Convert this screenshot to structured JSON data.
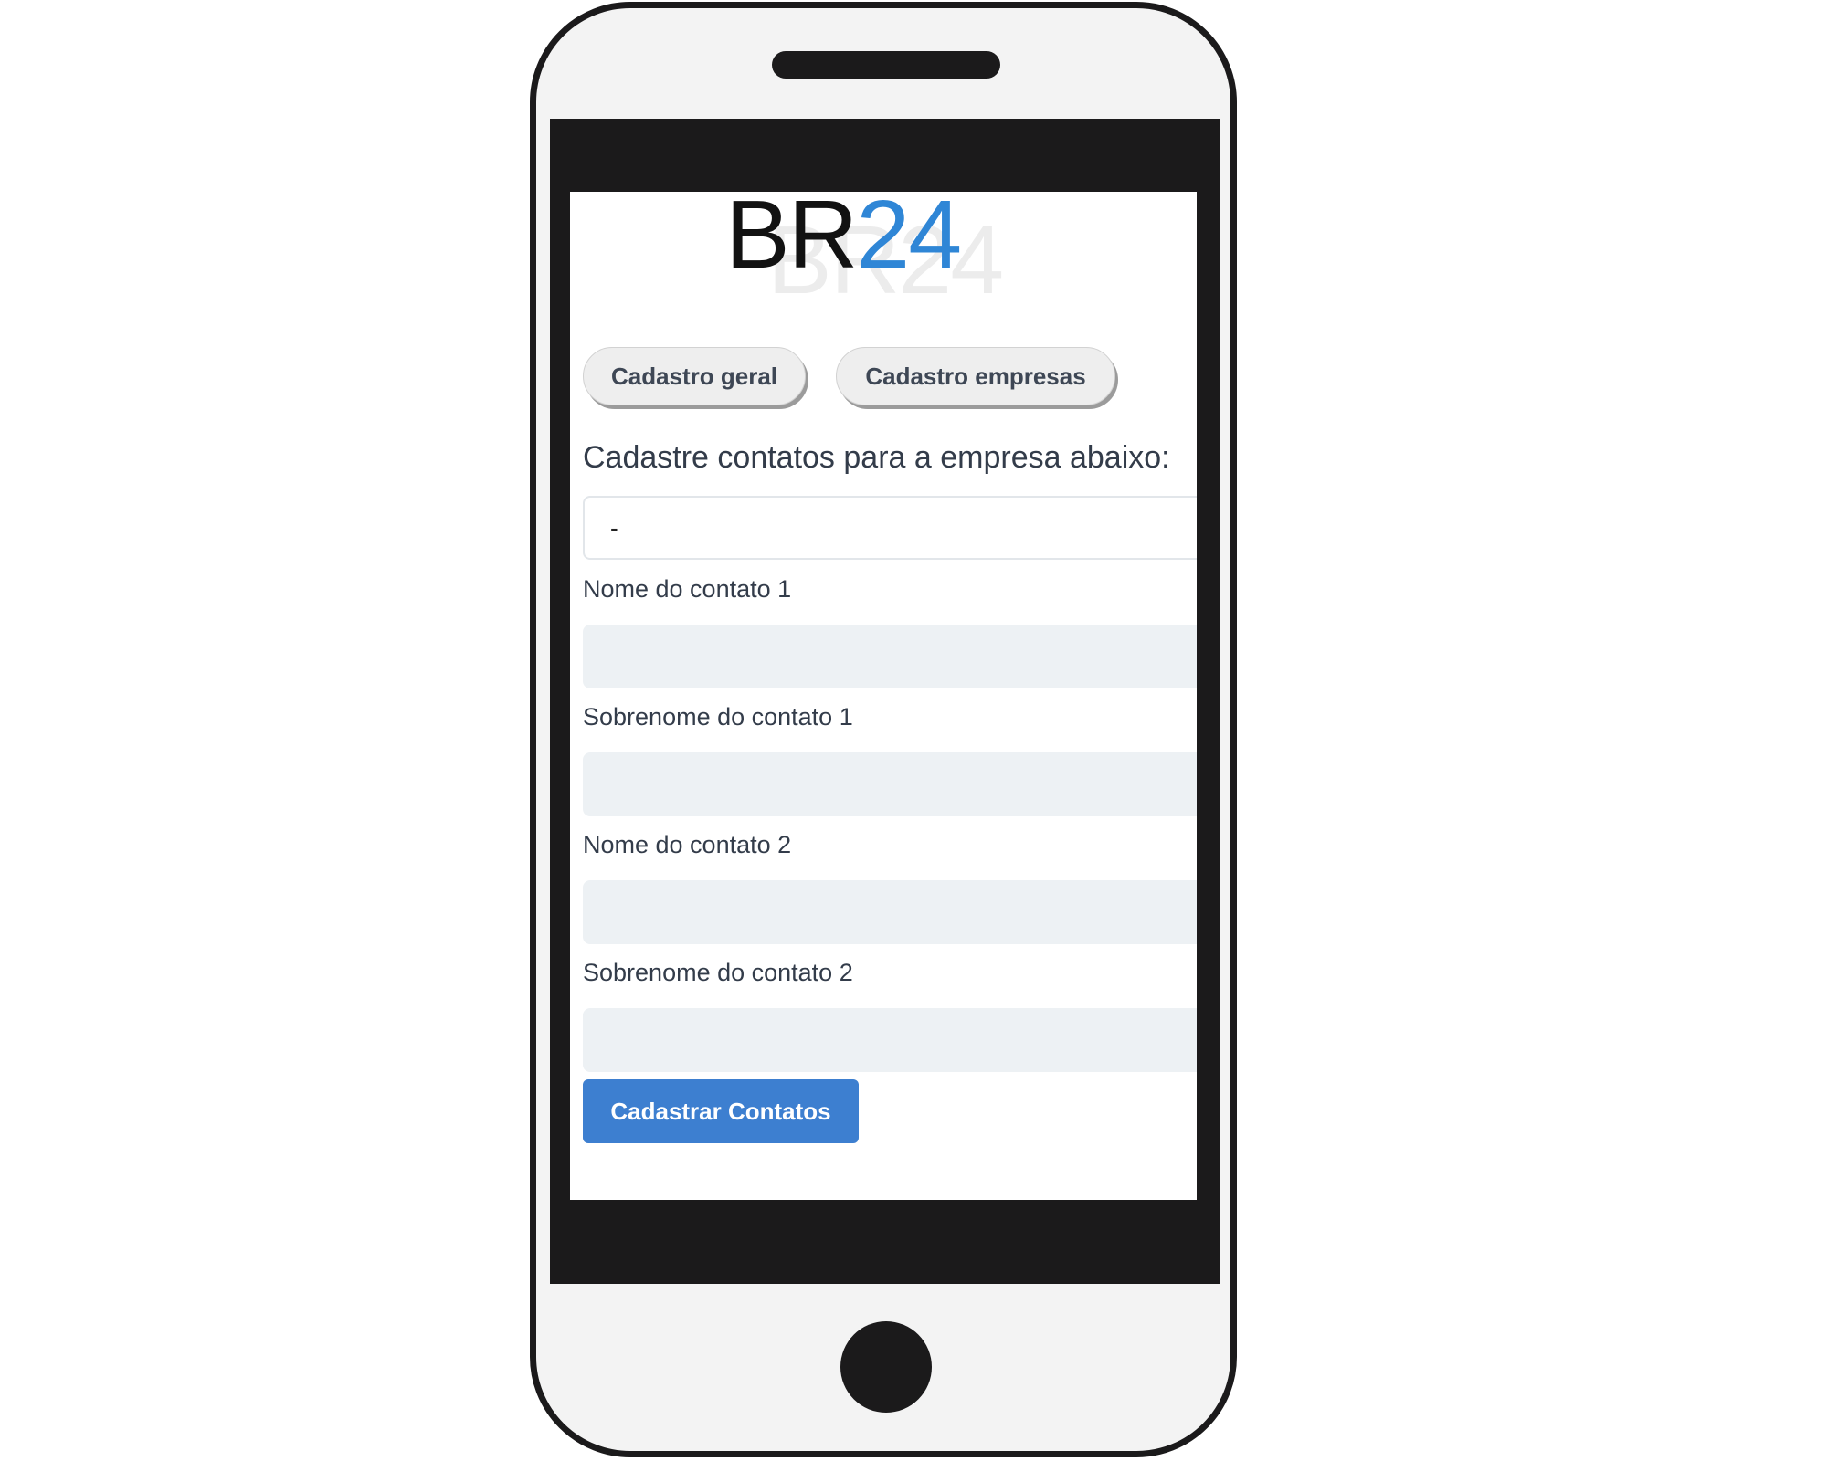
{
  "logo": {
    "prefix": "BR",
    "accent": "24",
    "shadow_text": "BR24",
    "accent_color": "#2f86d6"
  },
  "nav": {
    "items": [
      {
        "label": "Cadastro geral"
      },
      {
        "label": "Cadastro empresas"
      }
    ]
  },
  "form": {
    "heading": "Cadastre contatos para a empresa abaixo:",
    "company_select": {
      "value": "-"
    },
    "fields": [
      {
        "label": "Nome do contato 1",
        "value": ""
      },
      {
        "label": "Sobrenome do contato 1",
        "value": ""
      },
      {
        "label": "Nome do contato 2",
        "value": ""
      },
      {
        "label": "Sobrenome do contato 2",
        "value": ""
      }
    ],
    "submit_label": "Cadastrar Contatos",
    "submit_color": "#3d7fd0"
  }
}
